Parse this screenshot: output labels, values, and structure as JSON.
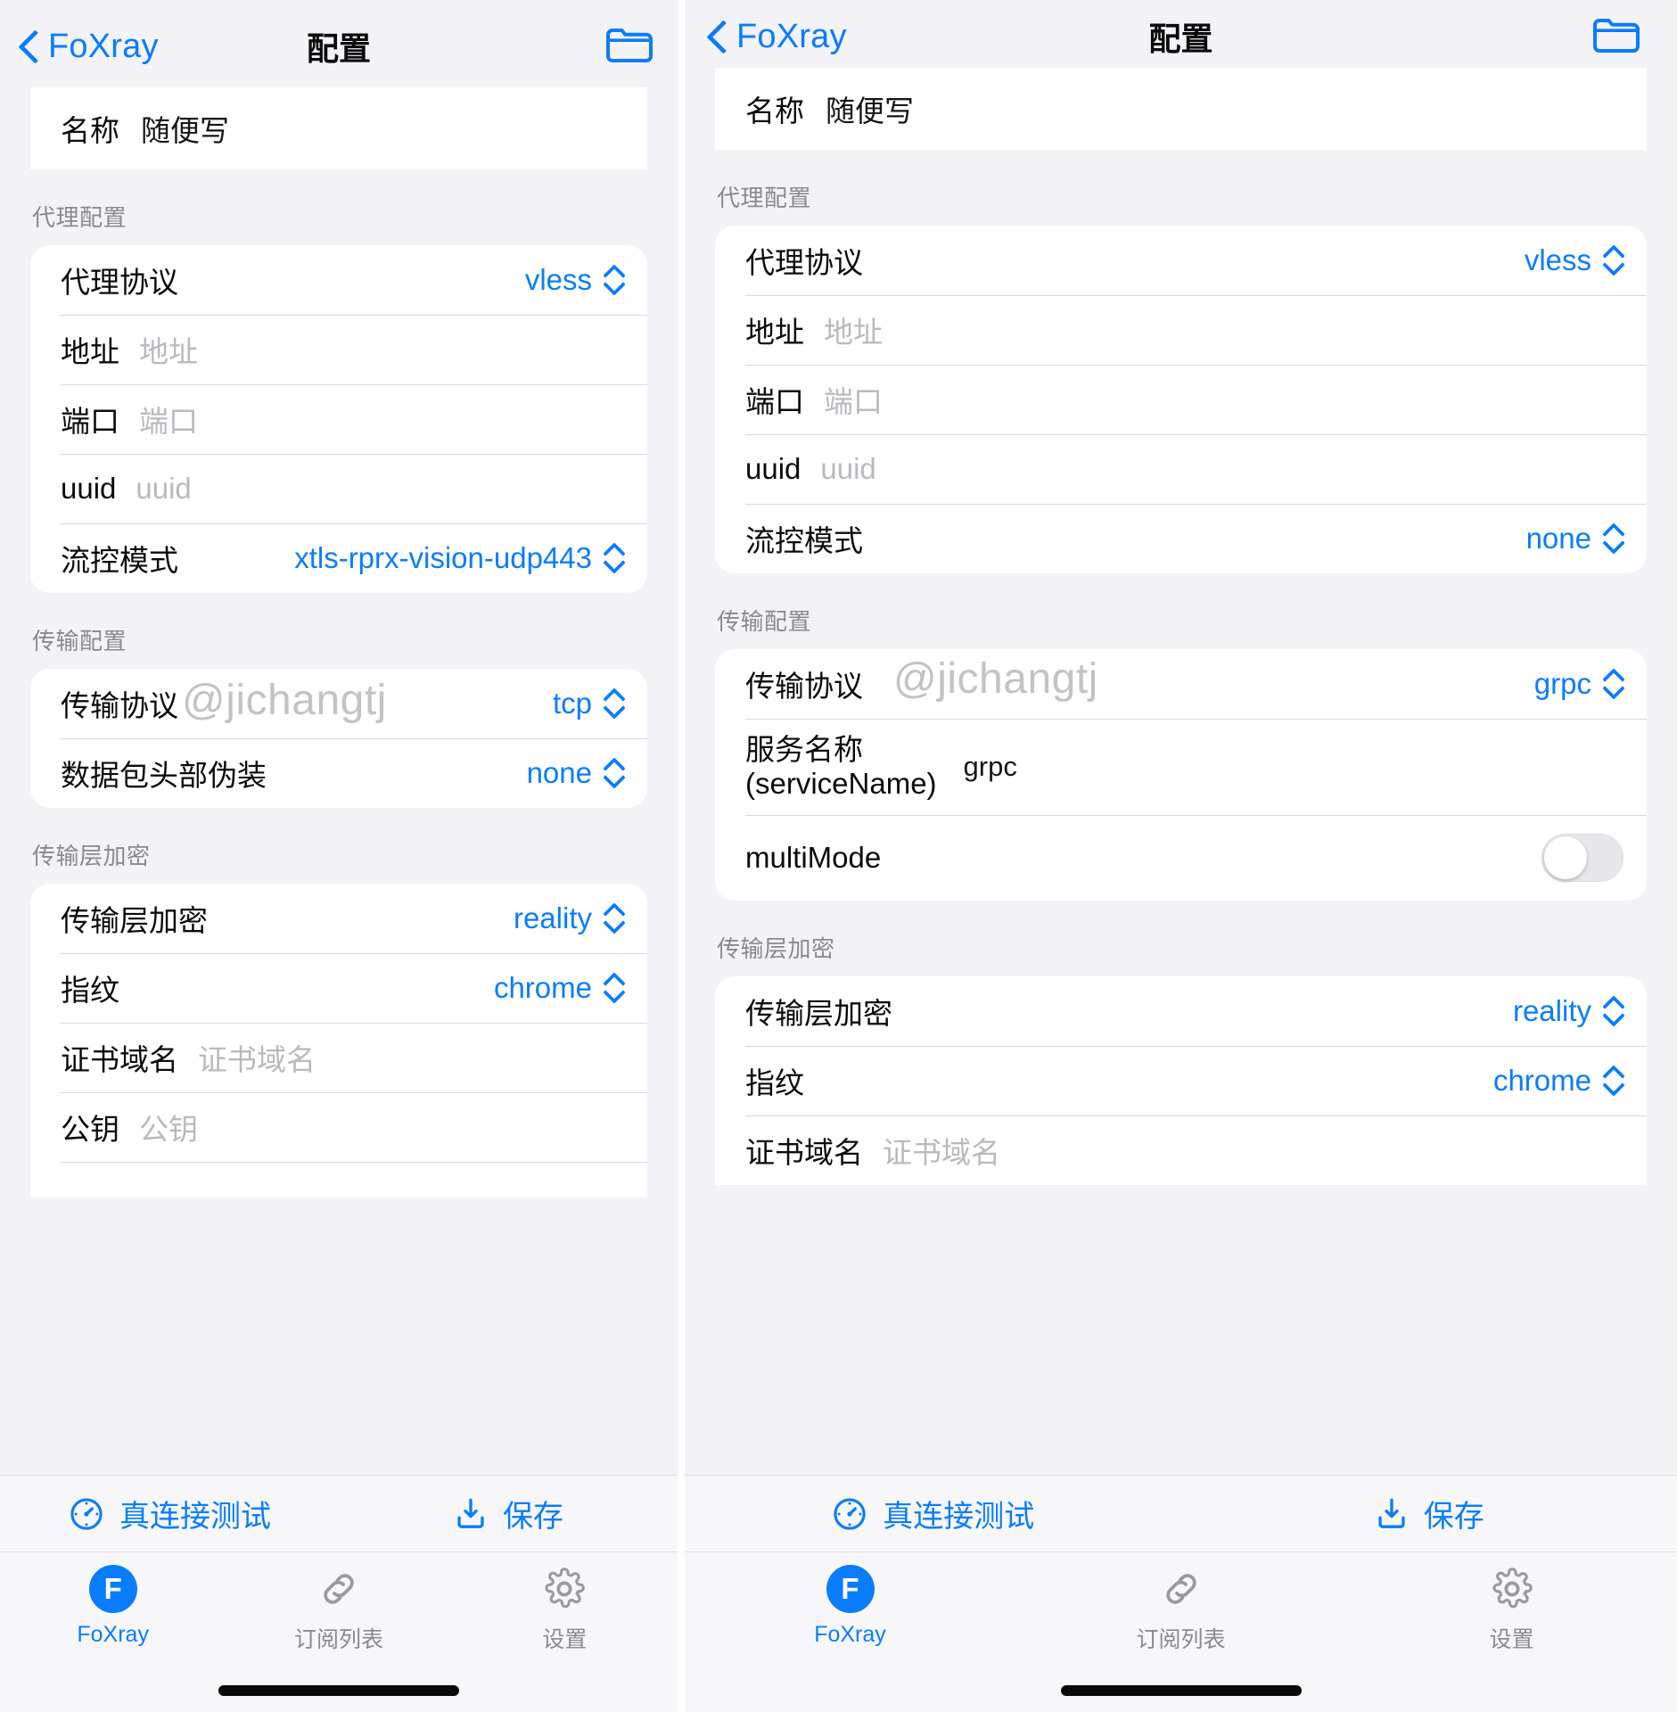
{
  "nav": {
    "back_label": "FoXray",
    "title": "配置",
    "folder_icon": "folder-icon",
    "back_icon": "chevron-left-icon"
  },
  "watermark": "@jichangtj",
  "left": {
    "name_row": {
      "label": "名称",
      "value": "随便写"
    },
    "sections": [
      {
        "header": "代理配置",
        "rows": [
          {
            "type": "select",
            "label": "代理协议",
            "value": "vless"
          },
          {
            "type": "input",
            "label": "地址",
            "placeholder": "地址",
            "value": ""
          },
          {
            "type": "input",
            "label": "端口",
            "placeholder": "端口",
            "value": ""
          },
          {
            "type": "input",
            "label": "uuid",
            "placeholder": "uuid",
            "value": ""
          },
          {
            "type": "select",
            "label": "流控模式",
            "value": "xtls-rprx-vision-udp443"
          }
        ]
      },
      {
        "header": "传输配置",
        "rows": [
          {
            "type": "select",
            "label": "传输协议",
            "value": "tcp"
          },
          {
            "type": "select",
            "label": "数据包头部伪装",
            "value": "none"
          }
        ]
      },
      {
        "header": "传输层加密",
        "rows": [
          {
            "type": "select",
            "label": "传输层加密",
            "value": "reality"
          },
          {
            "type": "select",
            "label": "指纹",
            "value": "chrome"
          },
          {
            "type": "input",
            "label": "证书域名",
            "placeholder": "证书域名",
            "value": ""
          },
          {
            "type": "input",
            "label": "公钥",
            "placeholder": "公钥",
            "value": ""
          }
        ]
      }
    ]
  },
  "right": {
    "name_row": {
      "label": "名称",
      "value": "随便写"
    },
    "sections": [
      {
        "header": "代理配置",
        "rows": [
          {
            "type": "select",
            "label": "代理协议",
            "value": "vless"
          },
          {
            "type": "input",
            "label": "地址",
            "placeholder": "地址",
            "value": ""
          },
          {
            "type": "input",
            "label": "端口",
            "placeholder": "端口",
            "value": ""
          },
          {
            "type": "input",
            "label": "uuid",
            "placeholder": "uuid",
            "value": ""
          },
          {
            "type": "select",
            "label": "流控模式",
            "value": "none"
          }
        ]
      },
      {
        "header": "传输配置",
        "rows": [
          {
            "type": "select",
            "label": "传输协议",
            "value": "grpc"
          },
          {
            "type": "plain",
            "label": "服务名称\n(serviceName)",
            "value": "grpc"
          },
          {
            "type": "toggle",
            "label": "multiMode",
            "value": "off"
          }
        ]
      },
      {
        "header": "传输层加密",
        "rows": [
          {
            "type": "select",
            "label": "传输层加密",
            "value": "reality"
          },
          {
            "type": "select",
            "label": "指纹",
            "value": "chrome"
          },
          {
            "type": "input",
            "label": "证书域名",
            "placeholder": "证书域名",
            "value": ""
          }
        ]
      }
    ]
  },
  "actions": {
    "test_label": "真连接测试",
    "test_icon": "speedometer-icon",
    "save_label": "保存",
    "save_icon": "save-download-icon"
  },
  "tabs": [
    {
      "label": "FoXray",
      "icon": "foxray-logo-icon",
      "active": true
    },
    {
      "label": "订阅列表",
      "icon": "link-icon",
      "active": false
    },
    {
      "label": "设置",
      "icon": "gear-icon",
      "active": false
    }
  ],
  "colors": {
    "accent": "#0a7cff",
    "page_bg": "#f2f2f7",
    "card_bg": "#ffffff",
    "separator": "#d9d9dd",
    "secondary_text": "#8a8a8e",
    "placeholder_text": "#b9b9bf"
  }
}
